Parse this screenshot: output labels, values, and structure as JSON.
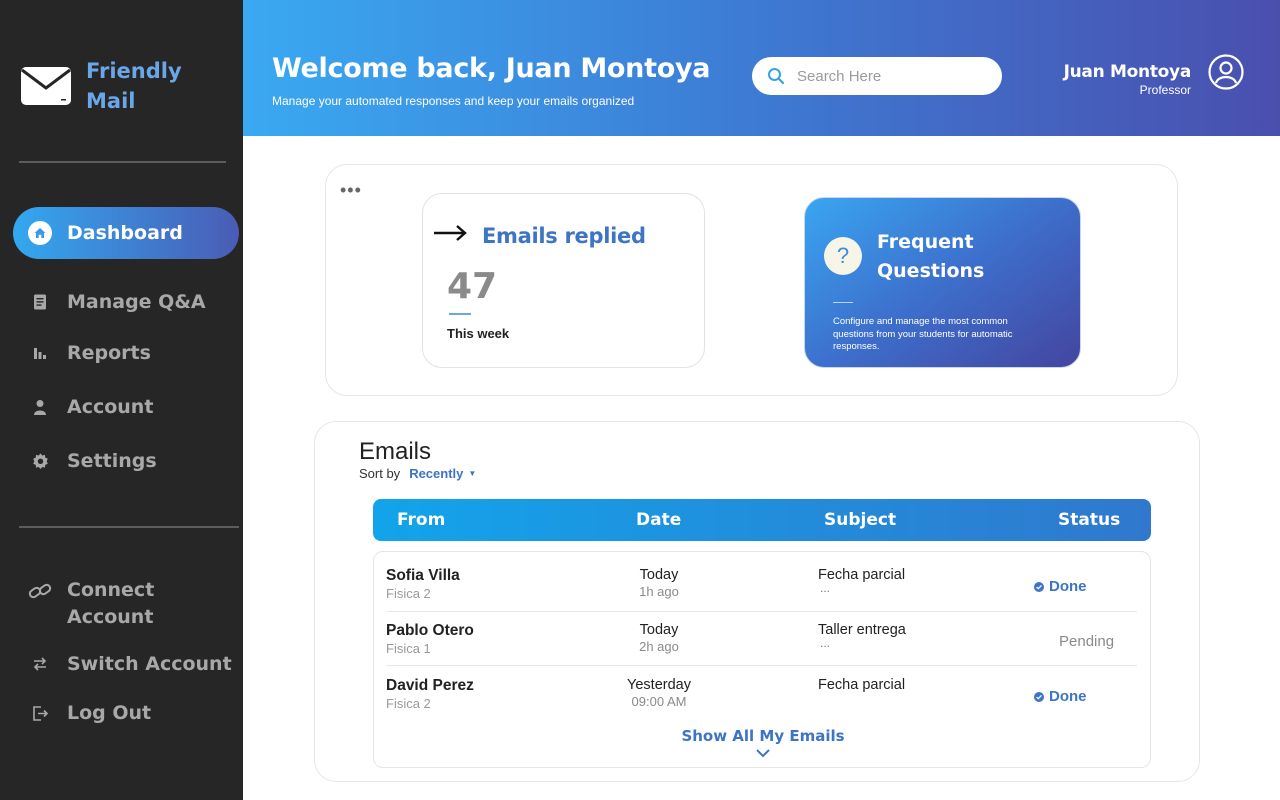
{
  "brand": {
    "name": "Friendly Mail"
  },
  "sidebar": {
    "items": [
      {
        "label": "Dashboard",
        "icon": "home-icon",
        "active": true
      },
      {
        "label": "Manage Q&A",
        "icon": "document-icon",
        "active": false
      },
      {
        "label": "Reports",
        "icon": "bar-chart-icon",
        "active": false
      },
      {
        "label": "Account",
        "icon": "user-icon",
        "active": false
      },
      {
        "label": "Settings",
        "icon": "gear-icon",
        "active": false
      }
    ],
    "bottom_items": [
      {
        "label": "Connect Account",
        "icon": "link-icon"
      },
      {
        "label": "Switch Account",
        "icon": "switch-arrows-icon"
      },
      {
        "label": "Log Out",
        "icon": "logout-icon"
      }
    ]
  },
  "header": {
    "title": "Welcome back, Juan Montoya",
    "subtitle": "Manage your automated responses and keep your emails organized",
    "search": {
      "placeholder": "Search Here",
      "value": ""
    },
    "user": {
      "name": "Juan Montoya",
      "role": "Professor"
    }
  },
  "stats": {
    "replied": {
      "title": "Emails replied",
      "value": "47",
      "caption": "This week"
    },
    "faq": {
      "title": "Frequent Questions",
      "description": "Configure and manage the most common questions from your students for automatic responses."
    }
  },
  "emails": {
    "title": "Emails",
    "sort_label": "Sort by",
    "sort_value": "Recently",
    "columns": [
      "From",
      "Date",
      "Subject",
      "Status"
    ],
    "rows": [
      {
        "from": "Sofia Villa",
        "course": "Fisica 2",
        "day": "Today",
        "time": "1h ago",
        "subject": "Fecha parcial",
        "preview": "...",
        "status": "Done"
      },
      {
        "from": "Pablo Otero",
        "course": "Fisica 1",
        "day": "Today",
        "time": "2h ago",
        "subject": "Taller entrega",
        "preview": "...",
        "status": "Pending"
      },
      {
        "from": "David Perez",
        "course": "Fisica 2",
        "day": "Yesterday",
        "time": "09:00 AM",
        "subject": "Fecha parcial",
        "preview": "...",
        "status": "Done"
      }
    ],
    "show_all": "Show All My Emails"
  },
  "colors": {
    "sidebar_bg": "#262626",
    "accent_blue": "#3d74c4",
    "brand_blue": "#6aa6e8",
    "header_gradient_start": "#3aa9f2",
    "header_gradient_end": "#4a4fae",
    "status_pending": "#8a8a8a"
  }
}
